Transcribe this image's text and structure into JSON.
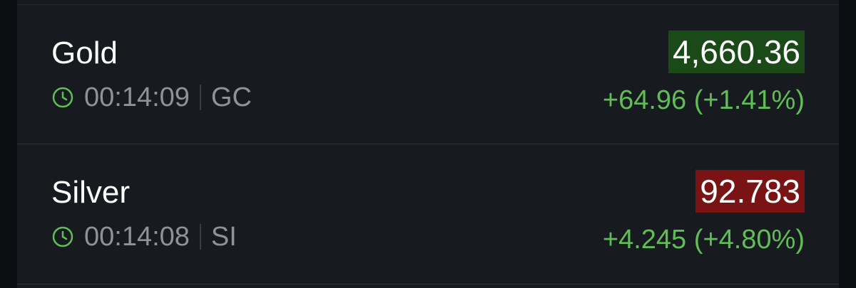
{
  "colors": {
    "background": "#171a1f",
    "price_up_bg": "#1a4a17",
    "price_down_bg": "#7a1414",
    "change_positive": "#5fbe55",
    "muted_text": "#8e9399",
    "clock_icon": "#5fbe55"
  },
  "quotes": [
    {
      "name": "Gold",
      "time": "00:14:09",
      "symbol": "GC",
      "price": "4,660.36",
      "price_direction": "up",
      "change": "+64.96 (+1.41%)",
      "icon": "clock-icon"
    },
    {
      "name": "Silver",
      "time": "00:14:08",
      "symbol": "SI",
      "price": "92.783",
      "price_direction": "down",
      "change": "+4.245 (+4.80%)",
      "icon": "clock-icon"
    }
  ]
}
